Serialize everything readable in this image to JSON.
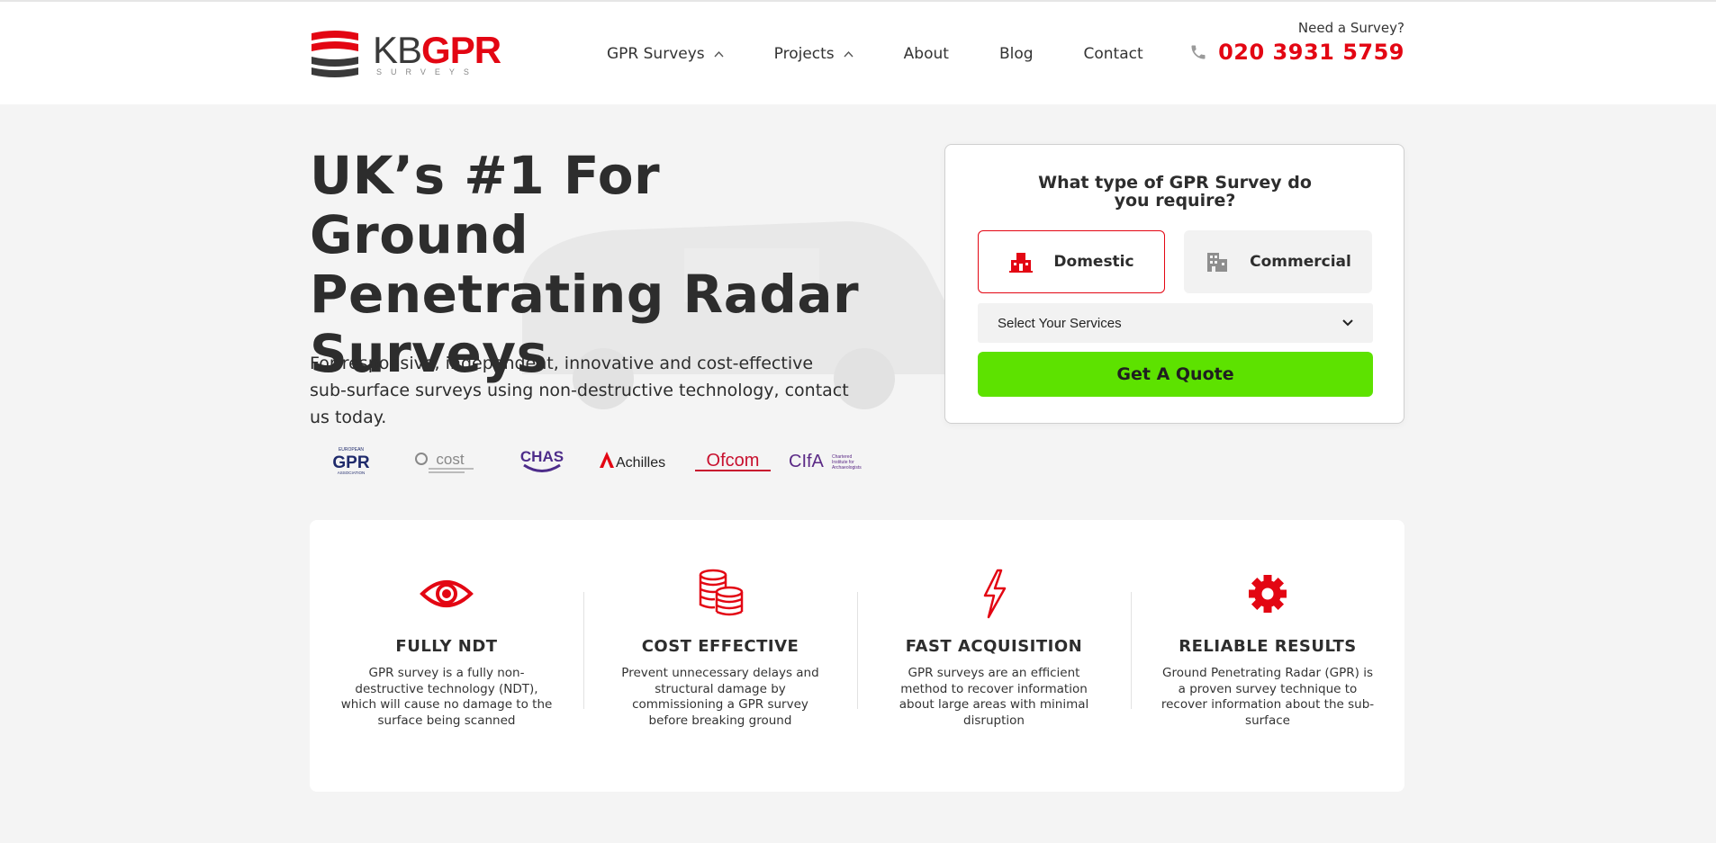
{
  "brand": {
    "logo_kb": "KB",
    "logo_gpr": "GPR",
    "logo_sub": "SURVEYS",
    "accent_color": "#e30613",
    "cta_color": "#5de200"
  },
  "nav": {
    "items": [
      {
        "label": "GPR Surveys",
        "dropdown": true
      },
      {
        "label": "Projects",
        "dropdown": true
      },
      {
        "label": "About",
        "dropdown": false
      },
      {
        "label": "Blog",
        "dropdown": false
      },
      {
        "label": "Contact",
        "dropdown": false
      }
    ]
  },
  "call": {
    "label": "Need a Survey?",
    "number": "020 3931 5759",
    "icon": "phone-icon"
  },
  "hero": {
    "title": "UK’s #1 For Ground Penetrating Radar Surveys",
    "subtitle": "For responsive, independent, innovative and cost-effective sub-surface surveys using non-destructive technology, contact us today.",
    "accreditations": [
      {
        "name": "European GPR Association",
        "mark": "GPR",
        "top": "EUROPEAN",
        "bottom": "ASSOCIATION"
      },
      {
        "name": "Constructionline",
        "mark": "cost"
      },
      {
        "name": "CHAS",
        "mark": "CHAS"
      },
      {
        "name": "Achilles",
        "mark": "Achilles"
      },
      {
        "name": "Ofcom",
        "mark": "Ofcom"
      },
      {
        "name": "CIfA",
        "mark": "CIfA",
        "caption": "Chartered Institute for Archaeologists"
      }
    ]
  },
  "quote": {
    "title": "What type of GPR Survey do you require?",
    "types": [
      {
        "label": "Domestic",
        "icon": "house-icon",
        "selected": true
      },
      {
        "label": "Commercial",
        "icon": "building-icon",
        "selected": false
      }
    ],
    "service_select": "Select Your Services",
    "button": "Get A Quote"
  },
  "features": [
    {
      "icon": "eye-icon",
      "title": "FULLY NDT",
      "text": "GPR survey is a fully non-destructive technology (NDT), which will cause no damage to the surface being scanned"
    },
    {
      "icon": "coins-icon",
      "title": "COST EFFECTIVE",
      "text": "Prevent unnecessary delays and structural damage by commissioning a GPR survey before breaking ground"
    },
    {
      "icon": "lightning-icon",
      "title": "FAST ACQUISITION",
      "text": "GPR surveys are an efficient method to recover information about large areas with minimal disruption"
    },
    {
      "icon": "gear-icon",
      "title": "RELIABLE RESULTS",
      "text": "Ground Penetrating Radar (GPR) is a proven survey technique to recover information about the sub-surface"
    }
  ]
}
